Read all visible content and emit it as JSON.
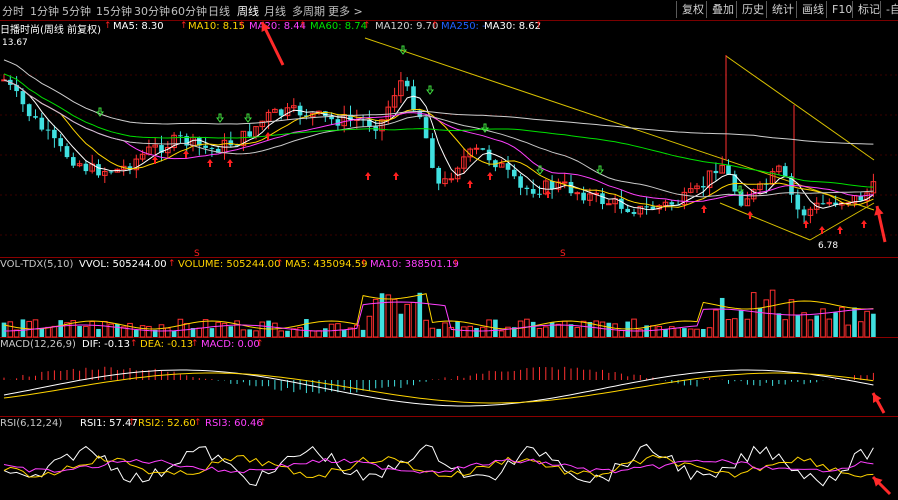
{
  "topbar": {
    "timeframes": [
      "分时",
      "1分钟",
      "5分钟",
      "15分钟",
      "30分钟",
      "60分钟",
      "日线",
      "周线",
      "月线",
      "多周期",
      "更多 >"
    ],
    "active": "周线",
    "buttons": [
      "复权",
      "叠加",
      "历史",
      "统计",
      "画线",
      "F10",
      "标记",
      "-自"
    ]
  },
  "main_panel": {
    "title": "日播时尚(周线 前复权)",
    "ma": [
      {
        "label": "MA5: 8.30",
        "color": "#ffffff"
      },
      {
        "label": "MA10: 8.15",
        "color": "#ffd400"
      },
      {
        "label": "MA20: 8.44",
        "color": "#ff40ff"
      },
      {
        "label": "MA60: 8.74",
        "color": "#00e000"
      },
      {
        "label": "MA120: 9.70",
        "color": "#d0d0d0"
      },
      {
        "label": "MA250: -",
        "color": "#2060ff"
      },
      {
        "label": "MA30: 8.62",
        "color": "#ffffff"
      }
    ],
    "high_label": "13.67",
    "low_label": "6.78",
    "s_marker": "S"
  },
  "volume_panel": {
    "title": "VOL-TDX(5,10)",
    "items": [
      {
        "label": "VVOL: 505244.00",
        "color": "#ffffff"
      },
      {
        "label": "VOLUME: 505244.00",
        "color": "#ffd400"
      },
      {
        "label": "MA5: 435094.59",
        "color": "#ffd400"
      },
      {
        "label": "MA10: 388501.19",
        "color": "#ff40ff"
      }
    ]
  },
  "macd_panel": {
    "title": "MACD(12,26,9)",
    "items": [
      {
        "label": "DIF: -0.13",
        "color": "#ffffff"
      },
      {
        "label": "DEA: -0.13",
        "color": "#ffd400"
      },
      {
        "label": "MACD: 0.00",
        "color": "#ff40ff"
      }
    ]
  },
  "rsi_panel": {
    "title": "RSI(6,12,24)",
    "items": [
      {
        "label": "RSI1: 57.47",
        "color": "#ffffff"
      },
      {
        "label": "RSI2: 52.60",
        "color": "#ffd400"
      },
      {
        "label": "RSI3: 60.46",
        "color": "#ff40ff"
      }
    ]
  },
  "colors": {
    "up": "#ff3030",
    "down": "#40e0e0",
    "annotation_arrow": "#ff2a2a",
    "trendline": "#d8c000"
  }
}
